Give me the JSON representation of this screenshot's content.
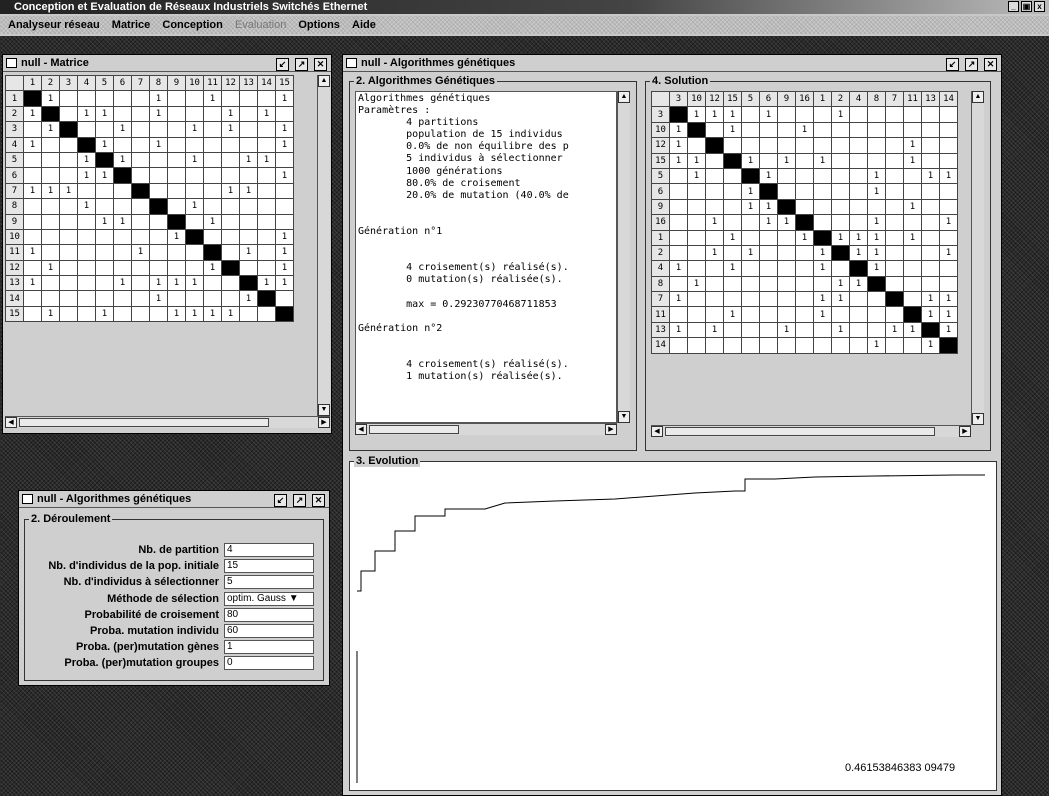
{
  "window": {
    "title": "Conception et Evaluation de Réseaux Industriels Switchés Ethernet",
    "controls": [
      "_",
      "▣",
      "x"
    ]
  },
  "menu": [
    {
      "label": "Analyseur réseau",
      "enabled": true
    },
    {
      "label": "Matrice",
      "enabled": true
    },
    {
      "label": "Conception",
      "enabled": true
    },
    {
      "label": "Evaluation",
      "enabled": false
    },
    {
      "label": "Options",
      "enabled": true
    },
    {
      "label": "Aide",
      "enabled": true
    }
  ],
  "matrix_frame": {
    "title": "null - Matrice",
    "col_headers": [
      "1",
      "2",
      "3",
      "4",
      "5",
      "6",
      "7",
      "8",
      "9",
      "10",
      "11",
      "12",
      "13",
      "14",
      "15"
    ],
    "row_headers": [
      "1",
      "2",
      "3",
      "4",
      "5",
      "6",
      "7",
      "8",
      "9",
      "10",
      "11",
      "12",
      "13",
      "14",
      "15"
    ],
    "cells": [
      [
        0,
        1,
        0,
        0,
        0,
        0,
        0,
        1,
        0,
        0,
        1,
        0,
        0,
        0,
        1
      ],
      [
        1,
        0,
        0,
        1,
        1,
        0,
        0,
        1,
        0,
        0,
        0,
        1,
        0,
        1,
        0
      ],
      [
        0,
        1,
        0,
        0,
        0,
        1,
        0,
        0,
        0,
        1,
        0,
        1,
        0,
        0,
        1
      ],
      [
        1,
        0,
        0,
        0,
        1,
        0,
        0,
        1,
        0,
        0,
        0,
        0,
        0,
        0,
        1
      ],
      [
        0,
        0,
        0,
        1,
        0,
        1,
        0,
        0,
        0,
        1,
        0,
        0,
        1,
        1,
        0
      ],
      [
        0,
        0,
        0,
        1,
        1,
        0,
        0,
        0,
        0,
        0,
        0,
        0,
        0,
        0,
        1
      ],
      [
        1,
        1,
        1,
        0,
        0,
        0,
        0,
        0,
        0,
        0,
        0,
        1,
        1,
        0,
        0
      ],
      [
        0,
        0,
        0,
        1,
        0,
        0,
        0,
        0,
        0,
        1,
        0,
        0,
        0,
        0,
        0
      ],
      [
        0,
        0,
        0,
        0,
        1,
        1,
        0,
        0,
        0,
        0,
        1,
        0,
        0,
        0,
        0
      ],
      [
        0,
        0,
        0,
        0,
        0,
        0,
        0,
        0,
        1,
        0,
        0,
        0,
        0,
        0,
        1
      ],
      [
        1,
        0,
        0,
        0,
        0,
        0,
        1,
        0,
        0,
        0,
        0,
        0,
        1,
        0,
        1
      ],
      [
        0,
        1,
        0,
        0,
        0,
        0,
        0,
        0,
        0,
        0,
        1,
        0,
        0,
        0,
        1
      ],
      [
        1,
        0,
        0,
        0,
        0,
        1,
        0,
        1,
        1,
        1,
        0,
        0,
        0,
        1,
        1
      ],
      [
        0,
        0,
        0,
        0,
        0,
        0,
        0,
        1,
        0,
        0,
        0,
        0,
        1,
        0,
        0
      ],
      [
        0,
        1,
        0,
        0,
        1,
        0,
        0,
        0,
        1,
        1,
        1,
        1,
        0,
        0,
        0
      ]
    ]
  },
  "algo_small": {
    "title": "null - Algorithmes génétiques",
    "group": "2. Déroulement",
    "fields": [
      {
        "label": "Nb. de partition",
        "value": "4"
      },
      {
        "label": "Nb. d'individus de la pop. initiale",
        "value": "15"
      },
      {
        "label": "Nb. d'individus à sélectionner",
        "value": "5"
      },
      {
        "label": "Méthode de sélection",
        "value": "optim. Gauss ▼"
      },
      {
        "label": "Probabilité de croisement",
        "value": "80"
      },
      {
        "label": "Proba. mutation individu",
        "value": "60"
      },
      {
        "label": "Proba. (per)mutation gènes",
        "value": "1"
      },
      {
        "label": "Proba. (per)mutation groupes",
        "value": "0"
      }
    ]
  },
  "algo_main": {
    "title": "null - Algorithmes génétiques",
    "log_group": "2. Algorithmes Génétiques",
    "log_lines": [
      "Algorithmes génétiques",
      "Paramètres :",
      "        4 partitions",
      "        population de 15 individus",
      "        0.0% de non équilibre des p",
      "        5 individus à sélectionner",
      "        1000 générations",
      "        80.0% de croisement",
      "        20.0% de mutation (40.0% de",
      "",
      "",
      "Génération n°1",
      "",
      "",
      "        4 croisement(s) réalisé(s).",
      "        0 mutation(s) réalisée(s).",
      "",
      "        max = 0.29230770468711853",
      "",
      "Génération n°2",
      "",
      "",
      "        4 croisement(s) réalisé(s).",
      "        1 mutation(s) réalisée(s)."
    ],
    "solution_group": "4. Solution",
    "sol_col_headers": [
      "3",
      "10",
      "12",
      "15",
      "5",
      "6",
      "9",
      "16",
      "1",
      "2",
      "4",
      "8",
      "7",
      "11",
      "13",
      "14"
    ],
    "sol_row_headers": [
      "3",
      "10",
      "12",
      "15",
      "5",
      "6",
      "9",
      "16",
      "1",
      "2",
      "4",
      "8",
      "7",
      "11",
      "13",
      "14"
    ],
    "sol_cells": [
      [
        0,
        1,
        1,
        1,
        0,
        1,
        0,
        0,
        0,
        1,
        0,
        0,
        0,
        0,
        0,
        0
      ],
      [
        1,
        0,
        0,
        1,
        0,
        0,
        0,
        1,
        0,
        0,
        0,
        0,
        0,
        0,
        0,
        0
      ],
      [
        1,
        0,
        0,
        0,
        0,
        0,
        0,
        0,
        0,
        0,
        0,
        0,
        0,
        1,
        0,
        0
      ],
      [
        1,
        1,
        0,
        0,
        1,
        0,
        1,
        0,
        1,
        0,
        0,
        0,
        0,
        1,
        0,
        0
      ],
      [
        0,
        1,
        0,
        0,
        0,
        1,
        0,
        0,
        0,
        0,
        0,
        1,
        0,
        0,
        1,
        1
      ],
      [
        0,
        0,
        0,
        0,
        1,
        0,
        0,
        0,
        0,
        0,
        0,
        1,
        0,
        0,
        0,
        0
      ],
      [
        0,
        0,
        0,
        0,
        1,
        1,
        0,
        0,
        0,
        0,
        0,
        0,
        0,
        1,
        0,
        0
      ],
      [
        0,
        0,
        1,
        0,
        0,
        1,
        1,
        0,
        0,
        0,
        0,
        1,
        0,
        0,
        0,
        1
      ],
      [
        0,
        0,
        0,
        1,
        0,
        0,
        0,
        1,
        0,
        1,
        1,
        1,
        0,
        1,
        0,
        0
      ],
      [
        0,
        0,
        1,
        0,
        1,
        0,
        0,
        0,
        1,
        0,
        1,
        1,
        0,
        0,
        0,
        1
      ],
      [
        1,
        0,
        0,
        1,
        0,
        0,
        0,
        0,
        1,
        0,
        0,
        1,
        0,
        0,
        0,
        0
      ],
      [
        0,
        1,
        0,
        0,
        0,
        0,
        0,
        0,
        0,
        1,
        1,
        0,
        0,
        0,
        0,
        0
      ],
      [
        1,
        0,
        0,
        0,
        0,
        0,
        0,
        0,
        1,
        1,
        0,
        0,
        0,
        0,
        1,
        1
      ],
      [
        0,
        0,
        0,
        1,
        0,
        0,
        0,
        0,
        1,
        0,
        0,
        0,
        0,
        0,
        1,
        1
      ],
      [
        1,
        0,
        1,
        0,
        0,
        0,
        1,
        0,
        0,
        1,
        0,
        0,
        1,
        1,
        0,
        1
      ],
      [
        0,
        0,
        0,
        0,
        0,
        0,
        0,
        0,
        0,
        0,
        0,
        1,
        0,
        0,
        1,
        0
      ]
    ],
    "evolution_group": "3. Evolution",
    "evolution_value": "0.46153846383 09479"
  }
}
